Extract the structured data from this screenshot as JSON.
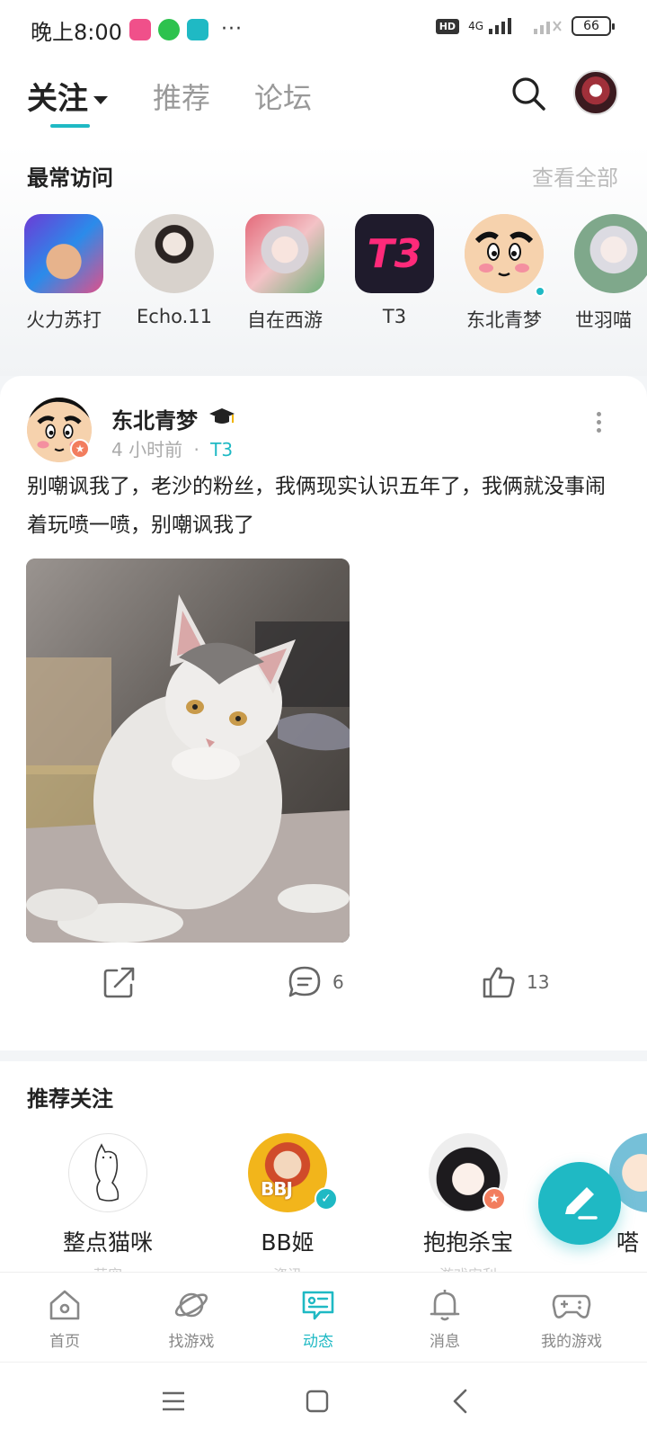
{
  "status_bar": {
    "time": "晚上8:00",
    "more": "···",
    "network": "4G",
    "hd": "HD",
    "battery": "66"
  },
  "header": {
    "tabs": [
      {
        "label": "关注",
        "active": true
      },
      {
        "label": "推荐",
        "active": false
      },
      {
        "label": "论坛",
        "active": false
      }
    ]
  },
  "recent": {
    "title": "最常访问",
    "view_all": "查看全部",
    "items": [
      {
        "label": "火力苏打"
      },
      {
        "label": "Echo.11"
      },
      {
        "label": "自在西游"
      },
      {
        "label": "T3",
        "logo_text": "T3"
      },
      {
        "label": "东北青梦"
      },
      {
        "label": "世羽喵"
      }
    ]
  },
  "post": {
    "author": "东北青梦",
    "time": "4 小时前",
    "separator": "·",
    "game": "T3",
    "content": "别嘲讽我了，老沙的粉丝，我俩现实认识五年了，我俩就没事闹着玩喷一喷，别嘲讽我了",
    "comments": "6",
    "likes": "13"
  },
  "recommend": {
    "title": "推荐关注",
    "users": [
      {
        "name": "整点猫咪",
        "sub": "萌宠"
      },
      {
        "name": "BB姬",
        "sub": "资讯"
      },
      {
        "name": "抱抱杀宝",
        "sub": "游戏安利"
      },
      {
        "name": "嗒",
        "sub": ""
      }
    ]
  },
  "nav": {
    "items": [
      {
        "label": "首页"
      },
      {
        "label": "找游戏"
      },
      {
        "label": "动态",
        "active": true
      },
      {
        "label": "消息"
      },
      {
        "label": "我的游戏"
      }
    ]
  },
  "colors": {
    "accent": "#1fb9c4",
    "badge": "#f27d5e",
    "text": "#222222",
    "muted": "#aaaaaa"
  }
}
